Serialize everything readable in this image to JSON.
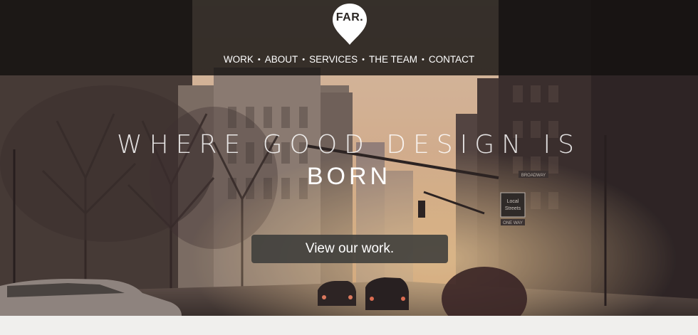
{
  "brand": {
    "logo_text": "FAR."
  },
  "nav": {
    "items": [
      {
        "label": "WORK"
      },
      {
        "label": "ABOUT"
      },
      {
        "label": "SERVICES"
      },
      {
        "label": "THE TEAM"
      },
      {
        "label": "CONTACT"
      }
    ],
    "separator": "•"
  },
  "hero": {
    "headline_line1": "WHERE GOOD DESIGN IS",
    "headline_line2": "BORN",
    "cta_label": "View our work.",
    "street_signs": [
      "Local Streets",
      "BROADWAY",
      "ONE WAY"
    ]
  },
  "colors": {
    "header_bg": "#141110",
    "cta_bg": "#3c3c3a",
    "text": "#ffffff",
    "page_bg": "#f0efed"
  }
}
